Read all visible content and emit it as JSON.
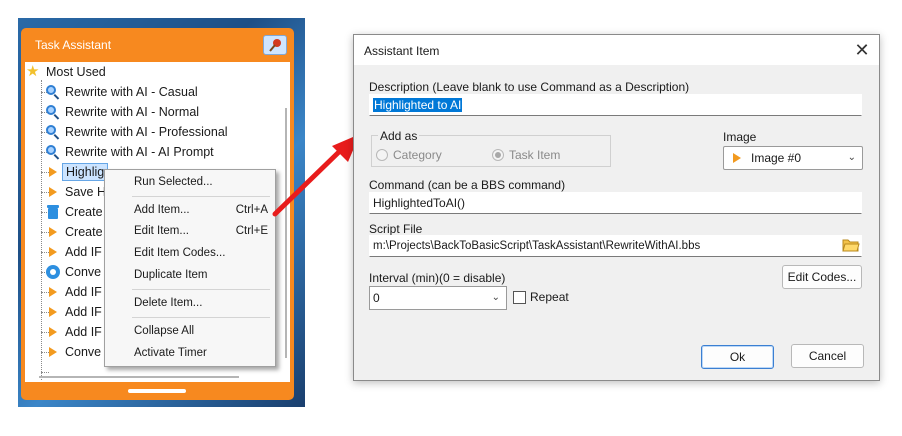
{
  "task_assistant": {
    "title": "Task Assistant",
    "pin_icon": "pin-icon",
    "tree": [
      {
        "label": "Most Used",
        "icon": "star-icon"
      },
      {
        "label": "Rewrite with AI - Casual",
        "icon": "magnifier-icon"
      },
      {
        "label": "Rewrite with AI - Normal",
        "icon": "magnifier-icon"
      },
      {
        "label": "Rewrite with AI - Professional",
        "icon": "magnifier-icon"
      },
      {
        "label": "Rewrite with AI - AI Prompt",
        "icon": "magnifier-icon"
      },
      {
        "label": "Highlig",
        "icon": "play-icon"
      },
      {
        "label": "Save H",
        "icon": "play-icon"
      },
      {
        "label": "Create",
        "icon": "trash-icon"
      },
      {
        "label": "Create",
        "icon": "play-icon"
      },
      {
        "label": "Add IF",
        "icon": "play-icon"
      },
      {
        "label": "Conve",
        "icon": "convert-icon"
      },
      {
        "label": "Add IF",
        "icon": "play-icon"
      },
      {
        "label": "Add IF",
        "icon": "play-icon"
      },
      {
        "label": "Add IF",
        "icon": "play-icon"
      },
      {
        "label": "Conve",
        "icon": "play-icon"
      }
    ]
  },
  "context_menu": {
    "items": [
      {
        "label": "Run Selected...",
        "shortcut": ""
      },
      {
        "label": "Add Item...",
        "shortcut": "Ctrl+A"
      },
      {
        "label": "Edit Item...",
        "shortcut": "Ctrl+E"
      },
      {
        "label": "Edit Item Codes...",
        "shortcut": ""
      },
      {
        "label": "Duplicate Item",
        "shortcut": ""
      },
      {
        "label": "Delete Item...",
        "shortcut": ""
      },
      {
        "label": "Collapse All",
        "shortcut": ""
      },
      {
        "label": "Activate Timer",
        "shortcut": ""
      }
    ]
  },
  "dialog": {
    "title": "Assistant Item",
    "description_label": "Description (Leave blank to use Command as a Description)",
    "description_value": "Highlighted to AI",
    "add_as_label": "Add as",
    "radio_category": "Category",
    "radio_task_item": "Task Item",
    "image_label": "Image",
    "image_value": "Image #0",
    "command_label": "Command (can be a BBS command)",
    "command_value": "HighlightedToAI()",
    "script_label": "Script File",
    "script_value": "m:\\Projects\\BackToBasicScript\\TaskAssistant\\RewriteWithAI.bbs",
    "interval_label": "Interval (min)(0 = disable)",
    "interval_value": "0",
    "repeat_label": "Repeat",
    "edit_codes_label": "Edit Codes...",
    "ok_label": "Ok",
    "cancel_label": "Cancel"
  },
  "colors": {
    "accent_orange": "#f7891f",
    "selection_blue": "#0078d7",
    "arrow_red": "#e81c1c"
  }
}
